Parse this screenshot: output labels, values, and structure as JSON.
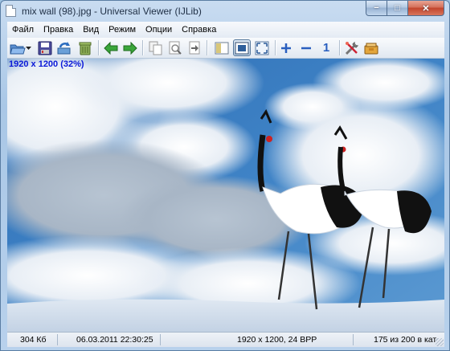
{
  "window": {
    "title": "mix wall (98).jpg - Universal Viewer (IJLib)",
    "icon": "document-icon",
    "buttons": [
      "minimize-icon",
      "maximize-icon",
      "close-icon"
    ]
  },
  "menu": [
    "Файл",
    "Правка",
    "Вид",
    "Режим",
    "Опции",
    "Справка"
  ],
  "toolbar": {
    "icons": [
      "open-folder-icon",
      "dropdown-arrow-icon",
      "save-icon",
      "reload-icon",
      "delete-icon",
      "back-arrow-icon",
      "forward-arrow-icon",
      "copy-icon",
      "print-preview-icon",
      "export-icon",
      "panel-icon",
      "fit-window-icon",
      "fullscreen-icon",
      "zoom-in-icon",
      "zoom-out-icon",
      "zoom-actual-icon",
      "tools-icon",
      "plugin-icon"
    ],
    "zoom_actual_label": "1"
  },
  "viewer": {
    "overlay_info": "1920 x 1200 (32%)",
    "image_description_id": "photo-two-cranes-snow-sky"
  },
  "status": {
    "size": "304 Кб",
    "date": "06.03.2011 22:30:25",
    "info": "1920 x 1200, 24 BPP",
    "position": "175 из 200 в кат"
  },
  "colors": {
    "overlay_text": "#0a18d8",
    "sky": "#2e6fb4",
    "accent_green": "#2e9a2e",
    "accent_blue": "#2a5fbf"
  }
}
